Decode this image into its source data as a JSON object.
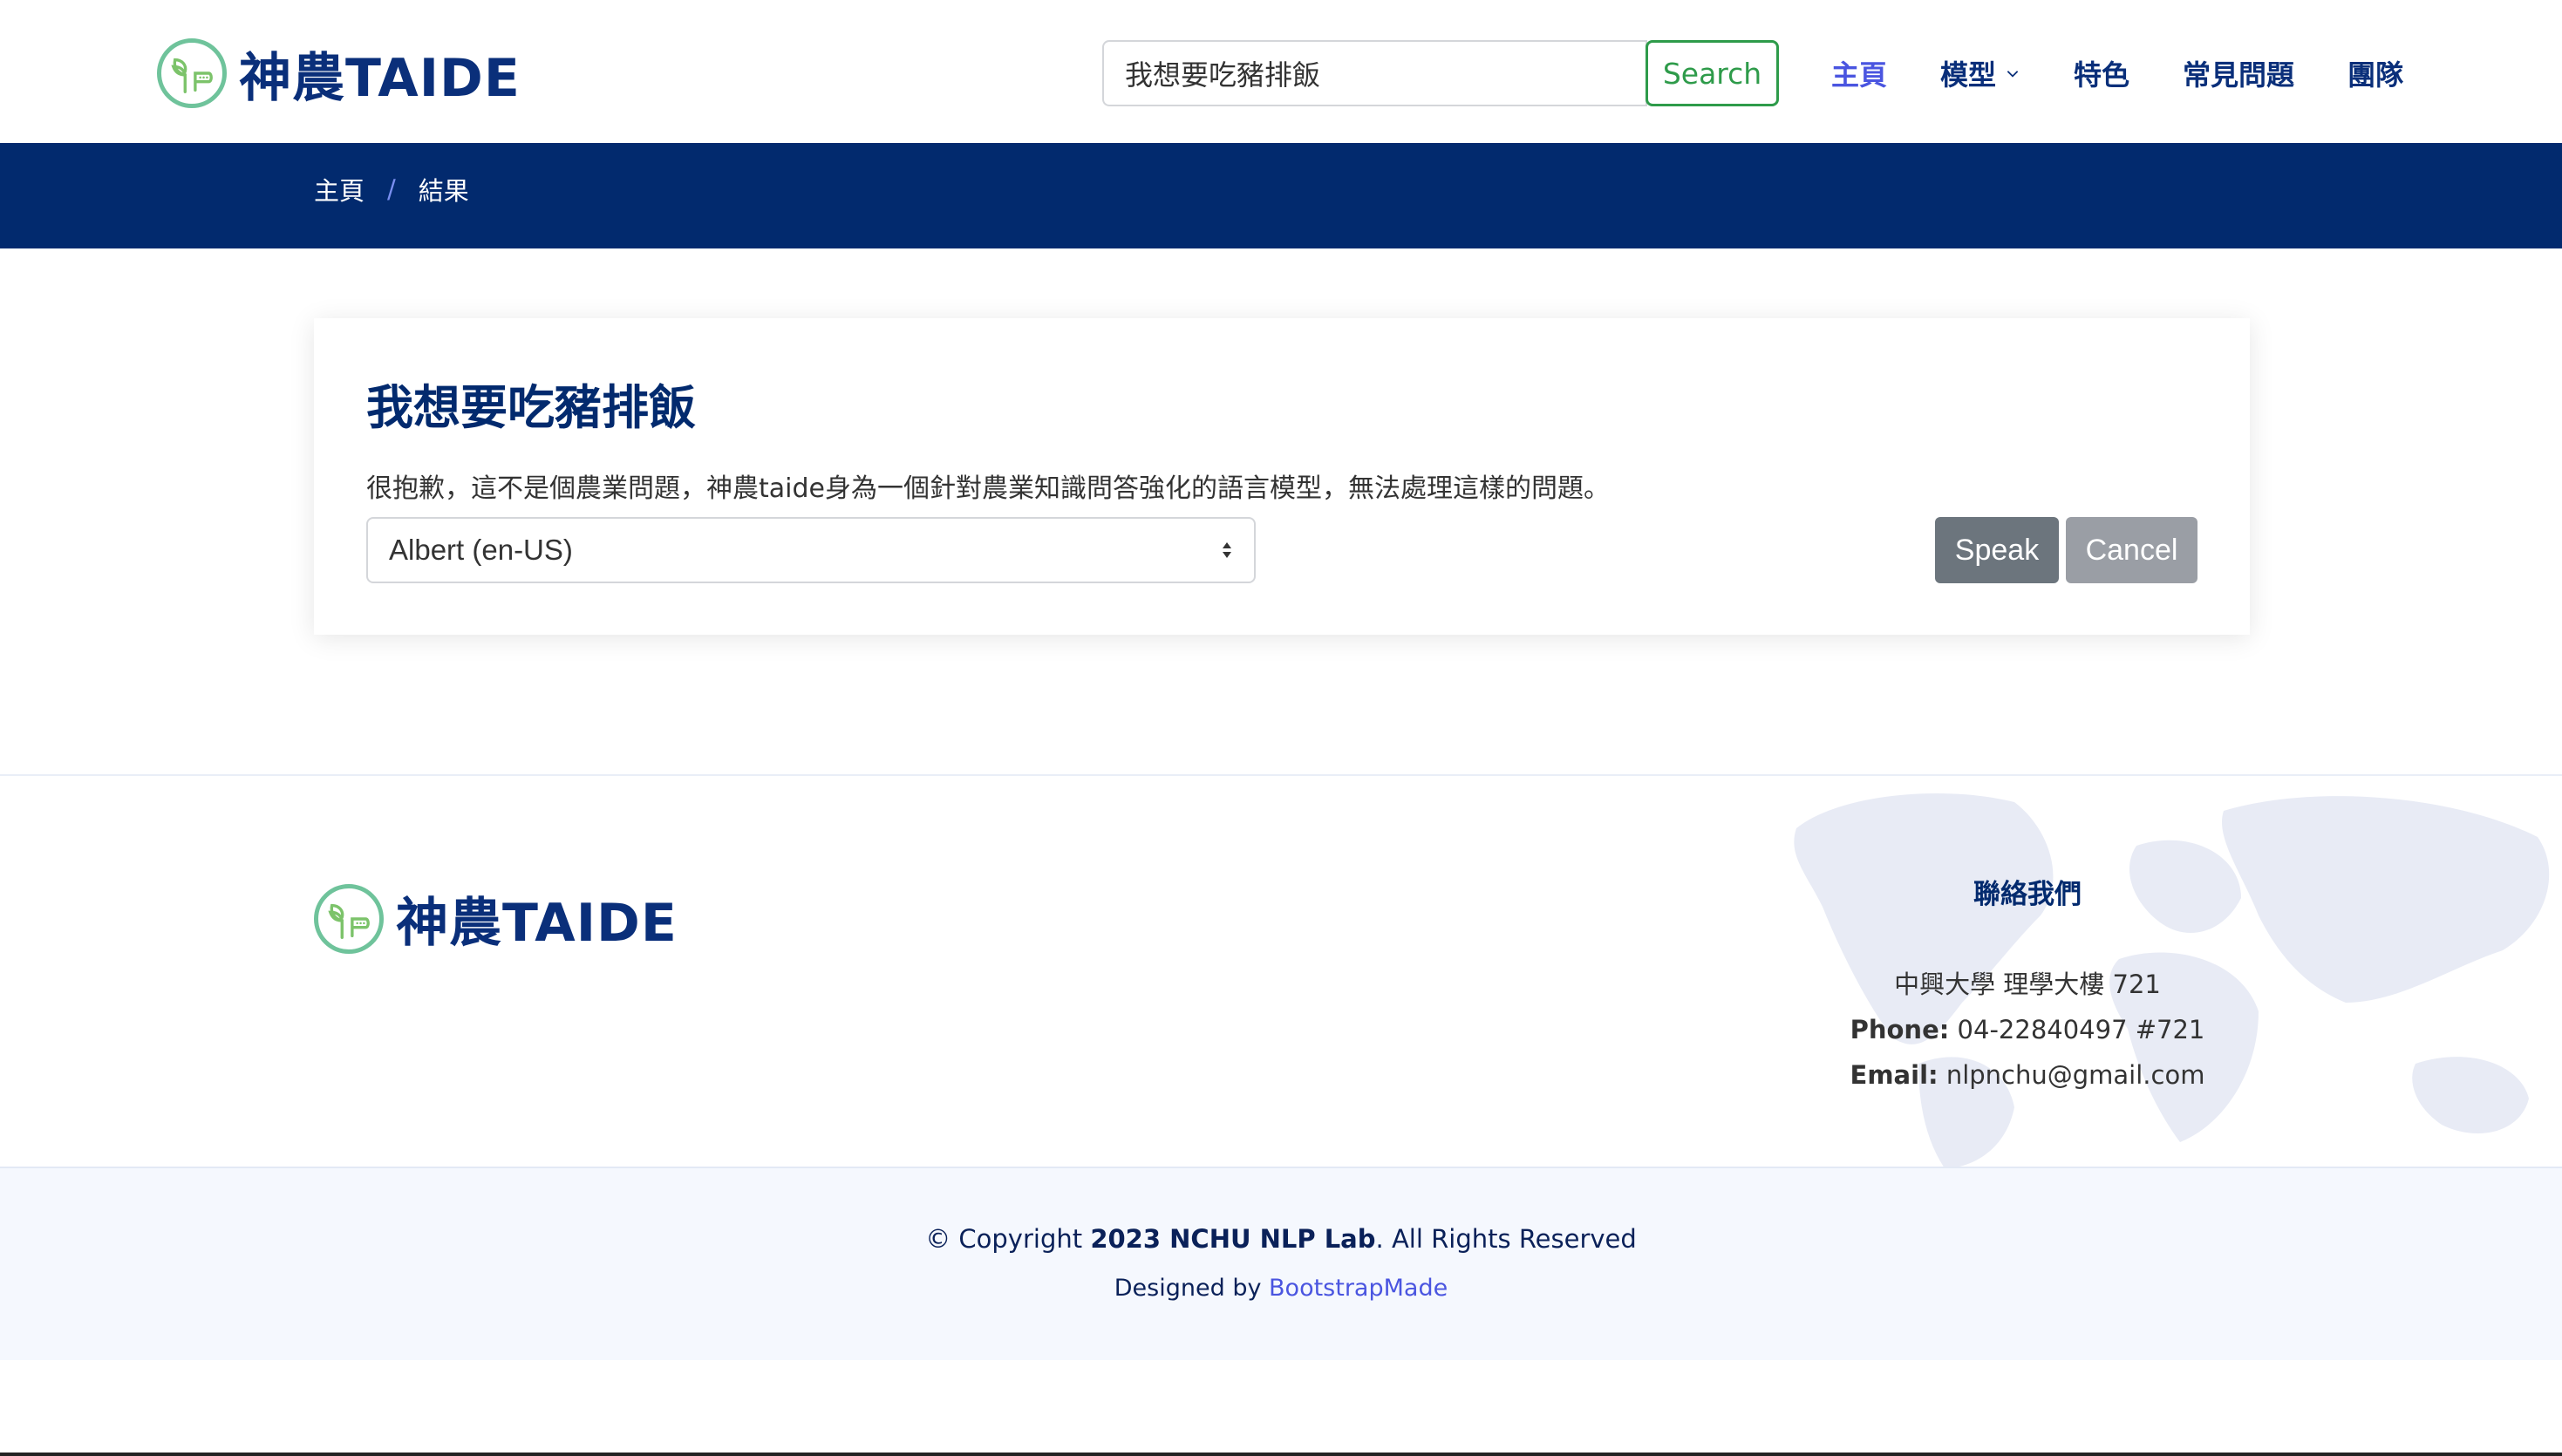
{
  "header": {
    "logo_text": "神農TAIDE",
    "search": {
      "value": "我想要吃豬排飯",
      "placeholder": "",
      "button_label": "Search"
    },
    "nav": [
      {
        "label": "主頁",
        "active": true
      },
      {
        "label": "模型",
        "has_dropdown": true
      },
      {
        "label": "特色"
      },
      {
        "label": "常見問題"
      },
      {
        "label": "團隊"
      }
    ]
  },
  "breadcrumb": {
    "items": [
      "主頁",
      "結果"
    ],
    "separator": "/"
  },
  "result": {
    "title": "我想要吃豬排飯",
    "answer": "很抱歉，這不是個農業問題，神農taide身為一個針對農業知識問答強化的語言模型，無法處理這樣的問題。",
    "voice_select_value": "Albert (en-US)",
    "speak_label": "Speak",
    "cancel_label": "Cancel"
  },
  "footer": {
    "logo_text": "神農TAIDE",
    "contact": {
      "heading": "聯絡我們",
      "address": "中興大學 理學大樓 721",
      "phone_label": "Phone:",
      "phone": "04-22840497 #721",
      "email_label": "Email:",
      "email": "nlpnchu@gmail.com"
    },
    "copyright_prefix": "© Copyright",
    "copyright_owner": "2023 NCHU NLP Lab",
    "copyright_suffix": ". All Rights Reserved",
    "credits_prefix": "Designed by",
    "credits_link": "BootstrapMade"
  },
  "colors": {
    "brand_navy": "#022a6e",
    "nav_active": "#4a55e0",
    "search_green": "#2e9b4a",
    "logo_green": "#6fc39b",
    "speak_gray": "#6c757d",
    "cancel_gray": "#9a9ea5"
  }
}
